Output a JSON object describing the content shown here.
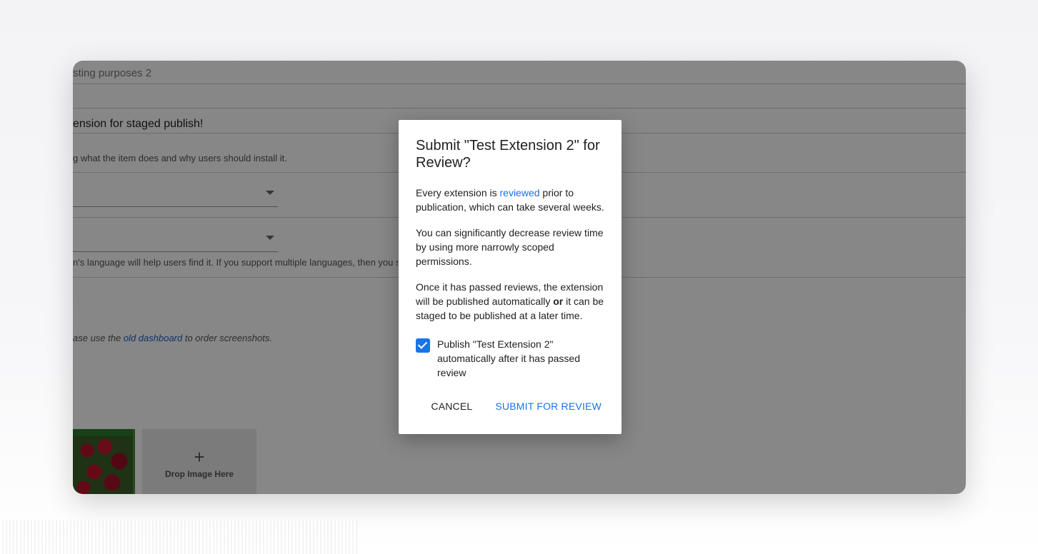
{
  "background_form": {
    "row_name_text": "sting purposes 2",
    "summary_text": "ension for staged publish!",
    "description_hint": "g what the item does and why users should install it.",
    "language_hint": "n's language will help users find it. If you support multiple languages, then you sh",
    "screenshots_note_prefix": "ase use the ",
    "screenshots_note_link": "old dashboard",
    "screenshots_note_suffix": " to order screenshots.",
    "drop_zone_plus": "+",
    "drop_zone_label": "Drop Image Here"
  },
  "dialog": {
    "title": "Submit \"Test Extension 2\" for Review?",
    "p1_prefix": "Every extension is ",
    "p1_link": "reviewed",
    "p1_suffix": " prior to publication, which can take several weeks.",
    "p2": "You can significantly decrease review time by using more narrowly scoped permissions.",
    "p3_prefix": "Once it has passed reviews, the extension will be published automatically ",
    "p3_bold": "or",
    "p3_suffix": " it can be staged to be published at a later time.",
    "checkbox_label": "Publish \"Test Extension 2\" automatically after it has passed review",
    "checkbox_checked": true,
    "cancel_label": "CANCEL",
    "submit_label": "SUBMIT FOR REVIEW"
  },
  "colors": {
    "accent": "#1a73e8",
    "scrim": "rgba(0,0,0,0.47)"
  }
}
